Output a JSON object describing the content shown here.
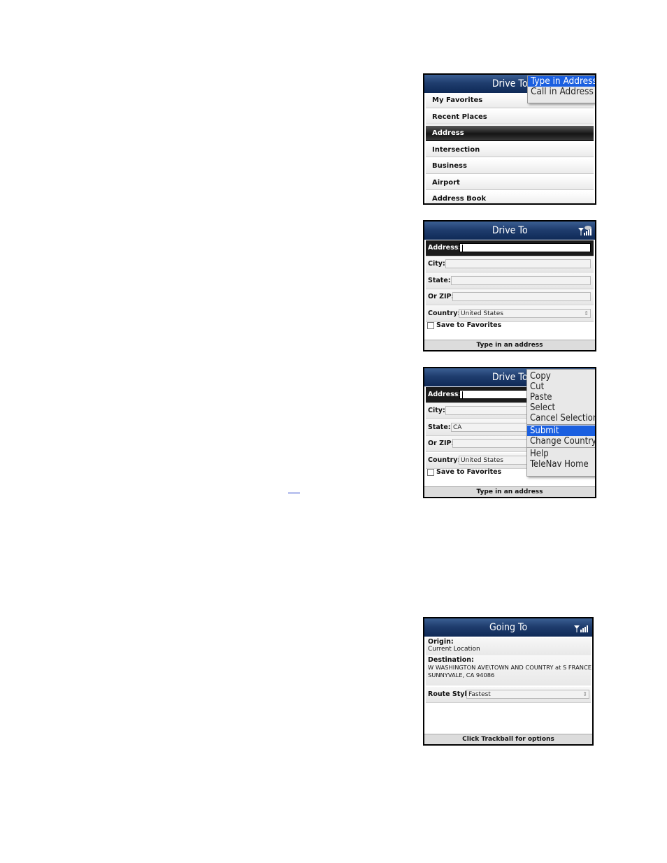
{
  "screen1": {
    "title": "Drive To",
    "items": [
      "My Favorites",
      "Recent Places",
      "Address",
      "Intersection",
      "Business",
      "Airport",
      "Address Book"
    ],
    "selected_index": 2,
    "menu": [
      "Type in Address",
      "Call in Address"
    ]
  },
  "screen2": {
    "title": "Drive To",
    "address_label": "Address:",
    "city_label": "City:",
    "state_label": "State:",
    "zip_label": "Or ZIP:",
    "country_label": "Country:",
    "country_value": "United States",
    "save_label": "Save to Favorites",
    "status": "Type in an address"
  },
  "screen3": {
    "title": "Drive To",
    "address_label": "Address:",
    "city_label": "City:",
    "state_label": "State:",
    "state_value": "CA",
    "zip_label": "Or ZIP:",
    "country_label": "Country:",
    "country_value": "United States",
    "save_label": "Save to Favorites",
    "status": "Type in an address",
    "menu_group1": [
      "Copy",
      "Cut",
      "Paste",
      "Select",
      "Cancel Selection"
    ],
    "menu_group2": [
      "Submit",
      "Change Country"
    ],
    "menu_group3": [
      "Help",
      "TeleNav Home"
    ]
  },
  "screen4": {
    "title": "Going To",
    "origin_label": "Origin:",
    "origin_value": "Current Location",
    "destination_label": "Destination:",
    "destination_line1": "W WASHINGTON AVE\\TOWN AND COUNTRY at S FRANCE...",
    "destination_line2": "SUNNYVALE, CA 94086",
    "route_label": "Route Style:",
    "route_value": "Fastest",
    "status": "Click Trackball for options"
  },
  "colors": {
    "title_bar": "#1f3d6e",
    "menu_highlight": "#1a5fe0",
    "link": "#1a35c9"
  }
}
